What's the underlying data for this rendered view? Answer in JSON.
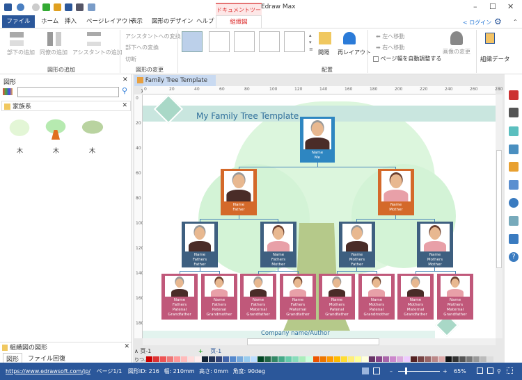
{
  "window": {
    "title": "Edraw Max",
    "context_tab_group": "ドキュメントツール",
    "controls": [
      "–",
      "☐",
      "✕"
    ]
  },
  "tabs": [
    {
      "label": "ファイル"
    },
    {
      "label": "ホーム"
    },
    {
      "label": "挿入"
    },
    {
      "label": "ページレイアウト"
    },
    {
      "label": "表示"
    },
    {
      "label": "図形のデザイン"
    },
    {
      "label": "ヘルプ"
    },
    {
      "label": "組織図"
    }
  ],
  "account": {
    "login": "ログイン"
  },
  "ribbon": {
    "add_group": {
      "label": "図形の追加",
      "buttons": [
        "部下の追加",
        "同僚の追加",
        "アシスタントの追加"
      ]
    },
    "change_group": {
      "label": "図形の変更",
      "buttons": [
        "アシスタントへの変換",
        "部下への変換",
        "切断"
      ]
    },
    "arrange_group": {
      "label": "配置",
      "spacing": "間隔",
      "relayout": "再レイアウト",
      "move_left": "左へ移動",
      "move_right": "右へ移動",
      "auto_fit": "ページ幅を自動調整する",
      "auto_fit_checked": false,
      "change_image": "画像の変更"
    },
    "org_data": "組織データ"
  },
  "left_panel": {
    "title": "図形",
    "search_placeholder": "",
    "library": "家族系",
    "shapes": [
      {
        "label": "木"
      },
      {
        "label": "木"
      },
      {
        "label": "木"
      }
    ],
    "bottom_title": "組織図の図形",
    "bottom_tabs": [
      "図形",
      "ファイル回復"
    ]
  },
  "document_tab": "Family Tree Template",
  "ruler": {
    "h": [
      "0",
      "20",
      "40",
      "60",
      "80",
      "100",
      "120",
      "140",
      "160",
      "180",
      "200",
      "220",
      "240",
      "260",
      "280"
    ],
    "v": [
      "0",
      "20",
      "40",
      "60",
      "80",
      "100",
      "120",
      "140",
      "160",
      "180"
    ]
  },
  "diagram": {
    "title": "My Family Tree Template",
    "footer": "Company name/Author",
    "colors": {
      "me": "#2e86c1",
      "parents": "#d4692a",
      "grandparents": "#3e5f80",
      "great": "#c0587a",
      "band": "#c9e6df"
    },
    "me": {
      "name": "Name",
      "role": "Me"
    },
    "parents": [
      {
        "name": "Name",
        "role": "Father"
      },
      {
        "name": "Name",
        "role": "Mother"
      }
    ],
    "grandparents": [
      {
        "name": "Name",
        "role": "Fathers Father"
      },
      {
        "name": "Name",
        "role": "Fathers Mother"
      },
      {
        "name": "Name",
        "role": "Mothers Father"
      },
      {
        "name": "Name",
        "role": "Mothers Mother"
      }
    ],
    "great_grandparents": [
      {
        "name": "Name",
        "role": "Fathers Patenal Grandfather"
      },
      {
        "name": "Name",
        "role": "Fathers Patenal Grandmother"
      },
      {
        "name": "Name",
        "role": "Fathers Maternal Grandfather"
      },
      {
        "name": "Name",
        "role": "Fathers Maternal Grandfather"
      },
      {
        "name": "Name",
        "role": "Mothers Patenal Grandfather"
      },
      {
        "name": "Name",
        "role": "Mothers Patenal Grandmother"
      },
      {
        "name": "Name",
        "role": "Mothers Maternal Grandfather"
      },
      {
        "name": "Name",
        "role": "Mothers Maternal Grandfather"
      }
    ]
  },
  "page_tabs": {
    "selector": "页-1",
    "active": "页-1",
    "add": "+"
  },
  "palette_label": "りつぶ",
  "status": {
    "url": "https://www.edrawsoft.com/jp/",
    "page": "ページ1/1",
    "shape_id": "図形ID: 216",
    "width": "幅: 210mm",
    "height": "高さ: 0mm",
    "angle": "角度: 90deg",
    "zoom": "65%"
  }
}
